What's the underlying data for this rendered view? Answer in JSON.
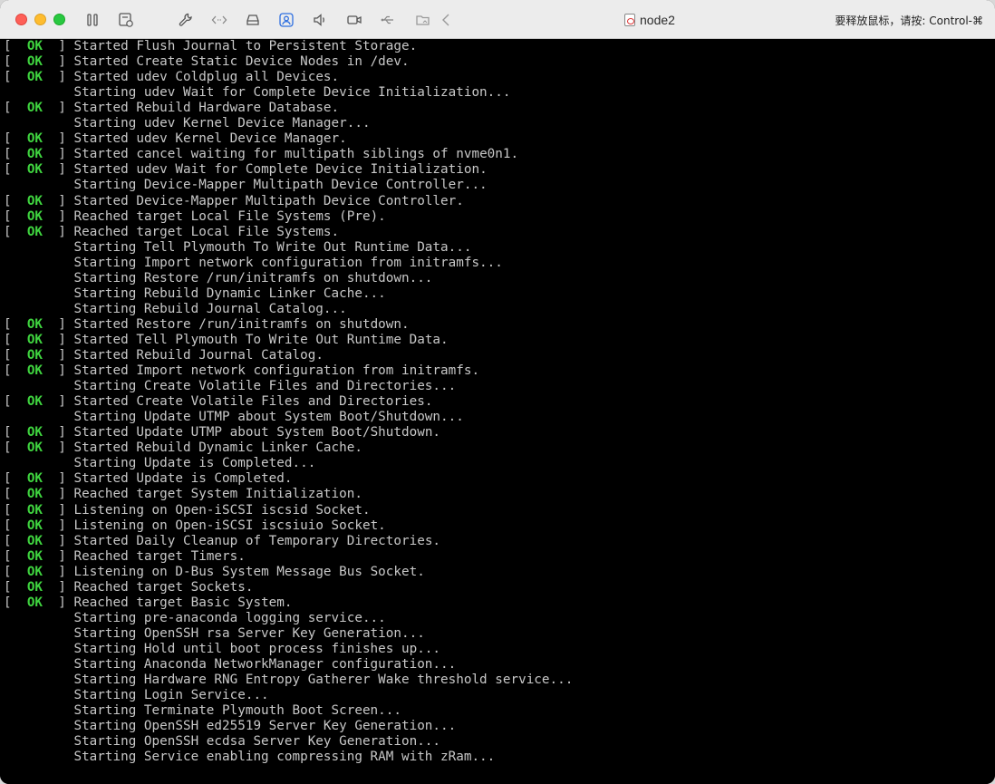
{
  "window": {
    "title": "node2",
    "release_hint": "要释放鼠标，请按: Control-⌘"
  },
  "toolbar": {
    "icons": [
      "pause-icon",
      "snapshot-icon",
      "settings-wrench-icon",
      "code-icon",
      "disk-icon",
      "user-sharing-icon",
      "sound-icon",
      "camera-icon",
      "usb-icon",
      "shared-folder-icon",
      "back-chevron-icon"
    ]
  },
  "colors": {
    "ok_green": "#3fd43f",
    "console_text": "#c8c8c8",
    "console_bg": "#000000"
  },
  "console": {
    "lines": [
      {
        "status": "OK",
        "text": "Started Flush Journal to Persistent Storage."
      },
      {
        "status": "OK",
        "text": "Started Create Static Device Nodes in /dev."
      },
      {
        "status": "OK",
        "text": "Started udev Coldplug all Devices."
      },
      {
        "status": "",
        "text": "Starting udev Wait for Complete Device Initialization..."
      },
      {
        "status": "OK",
        "text": "Started Rebuild Hardware Database."
      },
      {
        "status": "",
        "text": "Starting udev Kernel Device Manager..."
      },
      {
        "status": "OK",
        "text": "Started udev Kernel Device Manager."
      },
      {
        "status": "OK",
        "text": "Started cancel waiting for multipath siblings of nvme0n1."
      },
      {
        "status": "OK",
        "text": "Started udev Wait for Complete Device Initialization."
      },
      {
        "status": "",
        "text": "Starting Device-Mapper Multipath Device Controller..."
      },
      {
        "status": "OK",
        "text": "Started Device-Mapper Multipath Device Controller."
      },
      {
        "status": "OK",
        "text": "Reached target Local File Systems (Pre)."
      },
      {
        "status": "OK",
        "text": "Reached target Local File Systems."
      },
      {
        "status": "",
        "text": "Starting Tell Plymouth To Write Out Runtime Data..."
      },
      {
        "status": "",
        "text": "Starting Import network configuration from initramfs..."
      },
      {
        "status": "",
        "text": "Starting Restore /run/initramfs on shutdown..."
      },
      {
        "status": "",
        "text": "Starting Rebuild Dynamic Linker Cache..."
      },
      {
        "status": "",
        "text": "Starting Rebuild Journal Catalog..."
      },
      {
        "status": "OK",
        "text": "Started Restore /run/initramfs on shutdown."
      },
      {
        "status": "OK",
        "text": "Started Tell Plymouth To Write Out Runtime Data."
      },
      {
        "status": "OK",
        "text": "Started Rebuild Journal Catalog."
      },
      {
        "status": "OK",
        "text": "Started Import network configuration from initramfs."
      },
      {
        "status": "",
        "text": "Starting Create Volatile Files and Directories..."
      },
      {
        "status": "OK",
        "text": "Started Create Volatile Files and Directories."
      },
      {
        "status": "",
        "text": "Starting Update UTMP about System Boot/Shutdown..."
      },
      {
        "status": "OK",
        "text": "Started Update UTMP about System Boot/Shutdown."
      },
      {
        "status": "OK",
        "text": "Started Rebuild Dynamic Linker Cache."
      },
      {
        "status": "",
        "text": "Starting Update is Completed..."
      },
      {
        "status": "OK",
        "text": "Started Update is Completed."
      },
      {
        "status": "OK",
        "text": "Reached target System Initialization."
      },
      {
        "status": "OK",
        "text": "Listening on Open-iSCSI iscsid Socket."
      },
      {
        "status": "OK",
        "text": "Listening on Open-iSCSI iscsiuio Socket."
      },
      {
        "status": "OK",
        "text": "Started Daily Cleanup of Temporary Directories."
      },
      {
        "status": "OK",
        "text": "Reached target Timers."
      },
      {
        "status": "OK",
        "text": "Listening on D-Bus System Message Bus Socket."
      },
      {
        "status": "OK",
        "text": "Reached target Sockets."
      },
      {
        "status": "OK",
        "text": "Reached target Basic System."
      },
      {
        "status": "",
        "text": "Starting pre-anaconda logging service..."
      },
      {
        "status": "",
        "text": "Starting OpenSSH rsa Server Key Generation..."
      },
      {
        "status": "",
        "text": "Starting Hold until boot process finishes up..."
      },
      {
        "status": "",
        "text": "Starting Anaconda NetworkManager configuration..."
      },
      {
        "status": "",
        "text": "Starting Hardware RNG Entropy Gatherer Wake threshold service..."
      },
      {
        "status": "",
        "text": "Starting Login Service..."
      },
      {
        "status": "",
        "text": "Starting Terminate Plymouth Boot Screen..."
      },
      {
        "status": "",
        "text": "Starting OpenSSH ed25519 Server Key Generation..."
      },
      {
        "status": "",
        "text": "Starting OpenSSH ecdsa Server Key Generation..."
      },
      {
        "status": "",
        "text": "Starting Service enabling compressing RAM with zRam..."
      }
    ]
  }
}
